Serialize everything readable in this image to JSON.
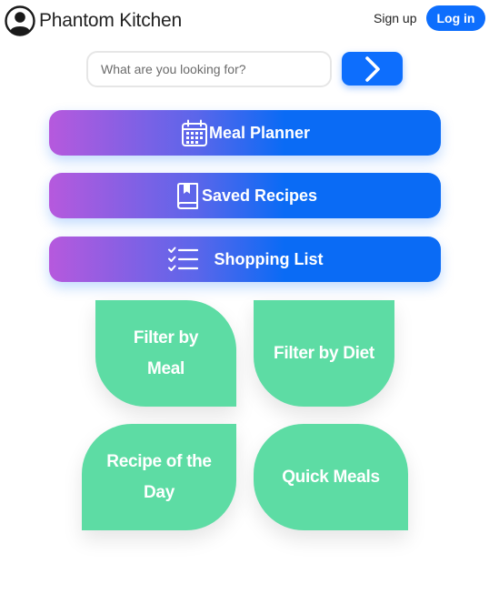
{
  "header": {
    "brand": "Phantom Kitchen",
    "signup_label": "Sign up",
    "login_label": "Log in"
  },
  "search": {
    "placeholder": "What are you looking for?",
    "submit_icon": "chevron-right-icon"
  },
  "menu": [
    {
      "label": "Meal Planner",
      "icon": "calendar-icon"
    },
    {
      "label": "Saved Recipes",
      "icon": "book-bookmark-icon"
    },
    {
      "label": "Shopping List",
      "icon": "checklist-icon"
    }
  ],
  "tiles": [
    {
      "label": "Filter by Meal"
    },
    {
      "label": "Filter by Diet"
    },
    {
      "label": "Recipe of the Day"
    },
    {
      "label": "Quick Meals"
    }
  ],
  "colors": {
    "primary": "#0d6efd",
    "gradient_start": "#b659dd",
    "tile_green": "#5ddca4"
  }
}
